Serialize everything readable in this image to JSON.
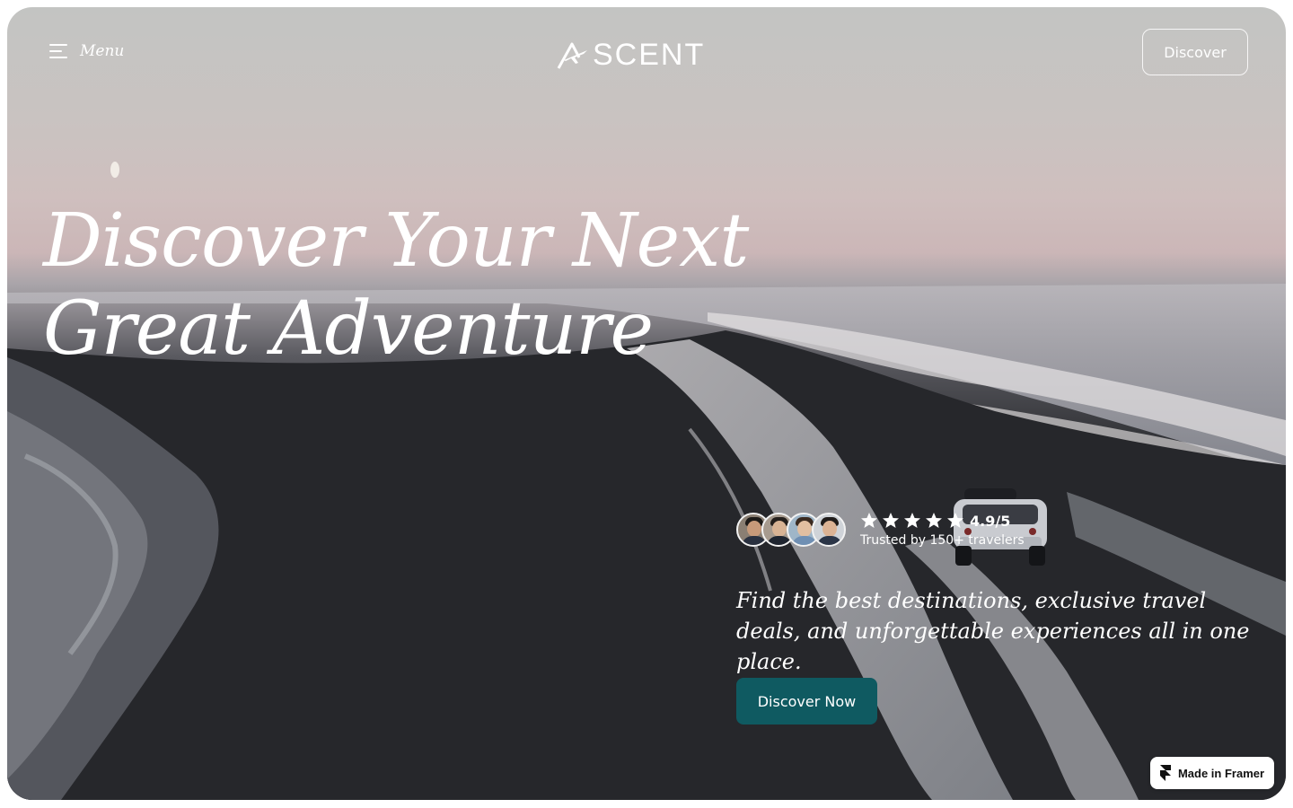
{
  "nav": {
    "menu_label": "Menu",
    "logo_text": "SCENT",
    "discover_label": "Discover"
  },
  "hero": {
    "headline_line1": "Discover Your Next",
    "headline_line2": "Great Adventure",
    "tagline": "Find the best destinations, exclusive travel deals, and unforgettable experiences all in one place.",
    "cta_label": "Discover Now"
  },
  "social_proof": {
    "rating": "4.9/5",
    "stars": 5,
    "trusted_text": "Trusted by 150+ travelers",
    "avatars": [
      "traveler-1",
      "traveler-2",
      "traveler-3",
      "traveler-4"
    ]
  },
  "badge": {
    "label": "Made in Framer"
  },
  "colors": {
    "accent": "#0f5a61",
    "text": "#ffffff"
  }
}
